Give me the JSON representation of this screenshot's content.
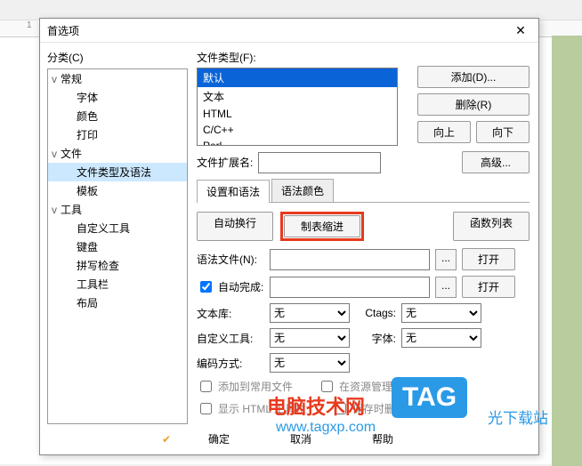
{
  "dialog": {
    "title": "首选项"
  },
  "left": {
    "label": "分类(C)"
  },
  "tree": {
    "items": [
      {
        "label": "常规",
        "level": 1,
        "toggle": "v"
      },
      {
        "label": "字体",
        "level": 2
      },
      {
        "label": "颜色",
        "level": 2
      },
      {
        "label": "打印",
        "level": 2
      },
      {
        "label": "文件",
        "level": 1,
        "toggle": "v"
      },
      {
        "label": "文件类型及语法",
        "level": 2,
        "sel": true
      },
      {
        "label": "模板",
        "level": 2
      },
      {
        "label": "工具",
        "level": 1,
        "toggle": "v"
      },
      {
        "label": "自定义工具",
        "level": 2
      },
      {
        "label": "键盘",
        "level": 2
      },
      {
        "label": "拼写检查",
        "level": 2
      },
      {
        "label": "工具栏",
        "level": 2
      },
      {
        "label": "布局",
        "level": 2
      }
    ]
  },
  "ftype": {
    "label": "文件类型(F):",
    "items": [
      "默认",
      "文本",
      "HTML",
      "C/C++",
      "Perl"
    ],
    "selected": 0
  },
  "buttons": {
    "add": "添加(D)...",
    "remove": "删除(R)",
    "up": "向上",
    "down": "向下",
    "advanced": "高级...",
    "funclist": "函数列表",
    "open": "打开",
    "ok": "确定",
    "cancel": "取消",
    "help": "帮助"
  },
  "ext": {
    "label": "文件扩展名:",
    "value": ""
  },
  "tabs": {
    "a": "设置和语法",
    "b": "语法颜色"
  },
  "tabbtns": {
    "a": "自动换行",
    "b": "制表缩进"
  },
  "syntax": {
    "label": "语法文件(N):",
    "value": ""
  },
  "auto": {
    "label": "自动完成:",
    "value": "",
    "checked": true
  },
  "combos": {
    "textlib": {
      "label": "文本库:",
      "value": "无"
    },
    "custom": {
      "label": "自定义工具:",
      "value": "无"
    },
    "encoding": {
      "label": "编码方式:",
      "value": "无"
    },
    "ctags": {
      "label": "Ctags:",
      "value": "无"
    },
    "font": {
      "label": "字体:",
      "value": "无"
    }
  },
  "checks": {
    "addcommon": "添加到常用文件",
    "showhtml": "显示 HTML 工具栏",
    "assoc": "在资源管理器关联文件",
    "trim": "保存时删除行末空格"
  },
  "watermark": {
    "a": "电脑技术网",
    "b": "TAG",
    "c": "www.tagxp.com",
    "d": "光下载站"
  }
}
